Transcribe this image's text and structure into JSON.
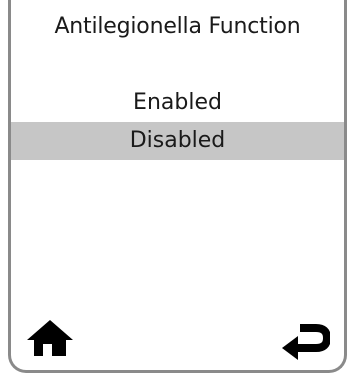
{
  "screen": {
    "title": "Antilegionella Function"
  },
  "options": [
    {
      "label": "Enabled",
      "selected": false
    },
    {
      "label": "Disabled",
      "selected": true
    }
  ],
  "icons": {
    "home": "home-icon",
    "back": "return-arrow-icon"
  },
  "colors": {
    "selected_bg": "#c6c6c6",
    "border": "#8a8a8a",
    "text": "#1a1a1a"
  }
}
